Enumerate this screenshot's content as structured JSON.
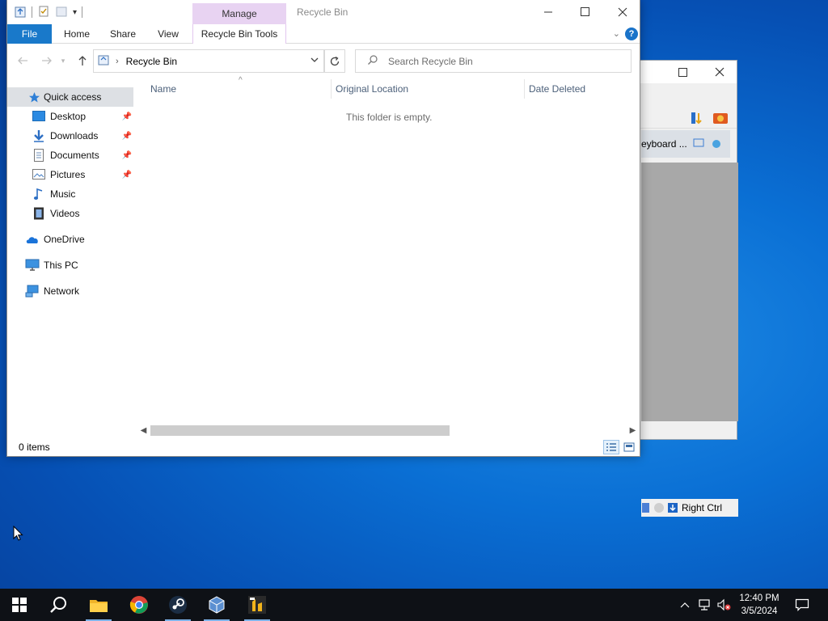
{
  "explorer": {
    "title": "Recycle Bin",
    "context_tab": "Manage",
    "ribbon_tabs": [
      "File",
      "Home",
      "Share",
      "View",
      "Recycle Bin Tools"
    ],
    "address": {
      "location": "Recycle Bin"
    },
    "search": {
      "placeholder": "Search Recycle Bin"
    },
    "nav": {
      "quick_access": "Quick access",
      "pinned": [
        "Desktop",
        "Downloads",
        "Documents",
        "Pictures"
      ],
      "unpinned": [
        "Music",
        "Videos"
      ],
      "onedrive": "OneDrive",
      "this_pc": "This PC",
      "network": "Network"
    },
    "columns": [
      "Name",
      "Original Location",
      "Date Deleted"
    ],
    "empty_message": "This folder is empty.",
    "status": {
      "item_count": "0 items"
    }
  },
  "background_window": {
    "vm_label": "eyboard ...",
    "host_key": "Right Ctrl"
  },
  "taskbar": {
    "clock": {
      "time": "12:40 PM",
      "date": "3/5/2024"
    }
  },
  "colors": {
    "accent": "#1979ca",
    "manage_tab": "#e8d3f2",
    "selection": "#dde0e4",
    "taskbar": "#0e1116"
  },
  "icons": [
    "windows-logo-icon",
    "search-icon",
    "file-explorer-icon",
    "chrome-icon",
    "steam-icon",
    "virtualbox-icon",
    "app-icon",
    "network-icon",
    "volume-muted-icon",
    "notifications-icon"
  ]
}
